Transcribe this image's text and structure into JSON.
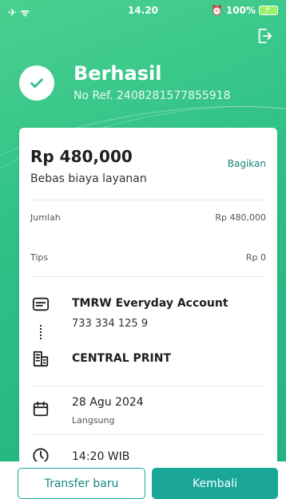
{
  "status_bar": {
    "time": "14.20",
    "battery": "100%"
  },
  "header": {
    "title": "Berhasil",
    "ref": "No Ref. 2408281577855918"
  },
  "receipt": {
    "amount": "Rp 480,000",
    "fee_note": "Bebas biaya layanan",
    "share_label": "Bagikan",
    "rows": [
      {
        "label": "Jumlah",
        "value": "Rp 480,000"
      },
      {
        "label": "Tips",
        "value": "Rp 0"
      }
    ],
    "from": {
      "name": "TMRW Everyday Account",
      "number": "733 334 125 9"
    },
    "to": {
      "name": "CENTRAL PRINT"
    },
    "date": {
      "value": "28 Agu 2024",
      "sub": "Langsung"
    },
    "time": {
      "value": "14:20 WIB"
    }
  },
  "actions": {
    "new_transfer": "Transfer baru",
    "back": "Kembali"
  },
  "colors": {
    "brand_green": "#2cbf86",
    "button_teal": "#1aa79a"
  },
  "icons": [
    "logout-icon",
    "checkmark-icon",
    "card-icon",
    "building-icon",
    "calendar-icon",
    "clock-icon"
  ]
}
